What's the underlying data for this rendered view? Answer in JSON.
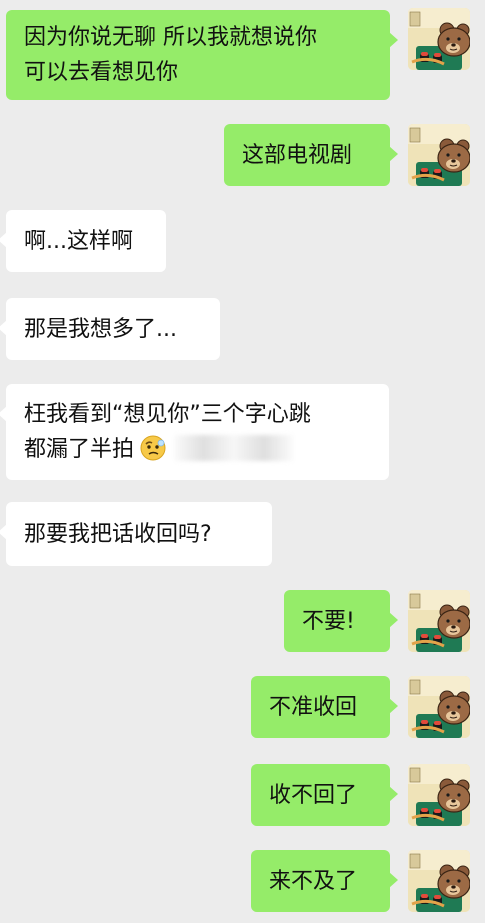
{
  "messages": [
    {
      "side": "right",
      "lines": [
        "因为你说无聊 所以我就想说你",
        "可以去看想见你"
      ]
    },
    {
      "side": "right",
      "lines": [
        "这部电视剧"
      ]
    },
    {
      "side": "left",
      "lines": [
        "啊...这样啊"
      ]
    },
    {
      "side": "left",
      "lines": [
        "那是我想多了..."
      ]
    },
    {
      "side": "left",
      "lines": [
        "枉我看到“想见你”三个字心跳",
        "都漏了半拍"
      ]
    },
    {
      "side": "left",
      "lines": [
        "那要我把话收回吗?"
      ]
    },
    {
      "side": "right",
      "lines": [
        "不要!"
      ]
    },
    {
      "side": "right",
      "lines": [
        "不准收回"
      ]
    },
    {
      "side": "right",
      "lines": [
        "收不回了"
      ]
    },
    {
      "side": "right",
      "lines": [
        "来不及了"
      ]
    }
  ],
  "icons": {
    "avatar": "bear-avatar-icon",
    "emoji": "confused-face-icon"
  },
  "colors": {
    "background": "#ececec",
    "sent_bubble": "#95ec69",
    "received_bubble": "#ffffff"
  }
}
